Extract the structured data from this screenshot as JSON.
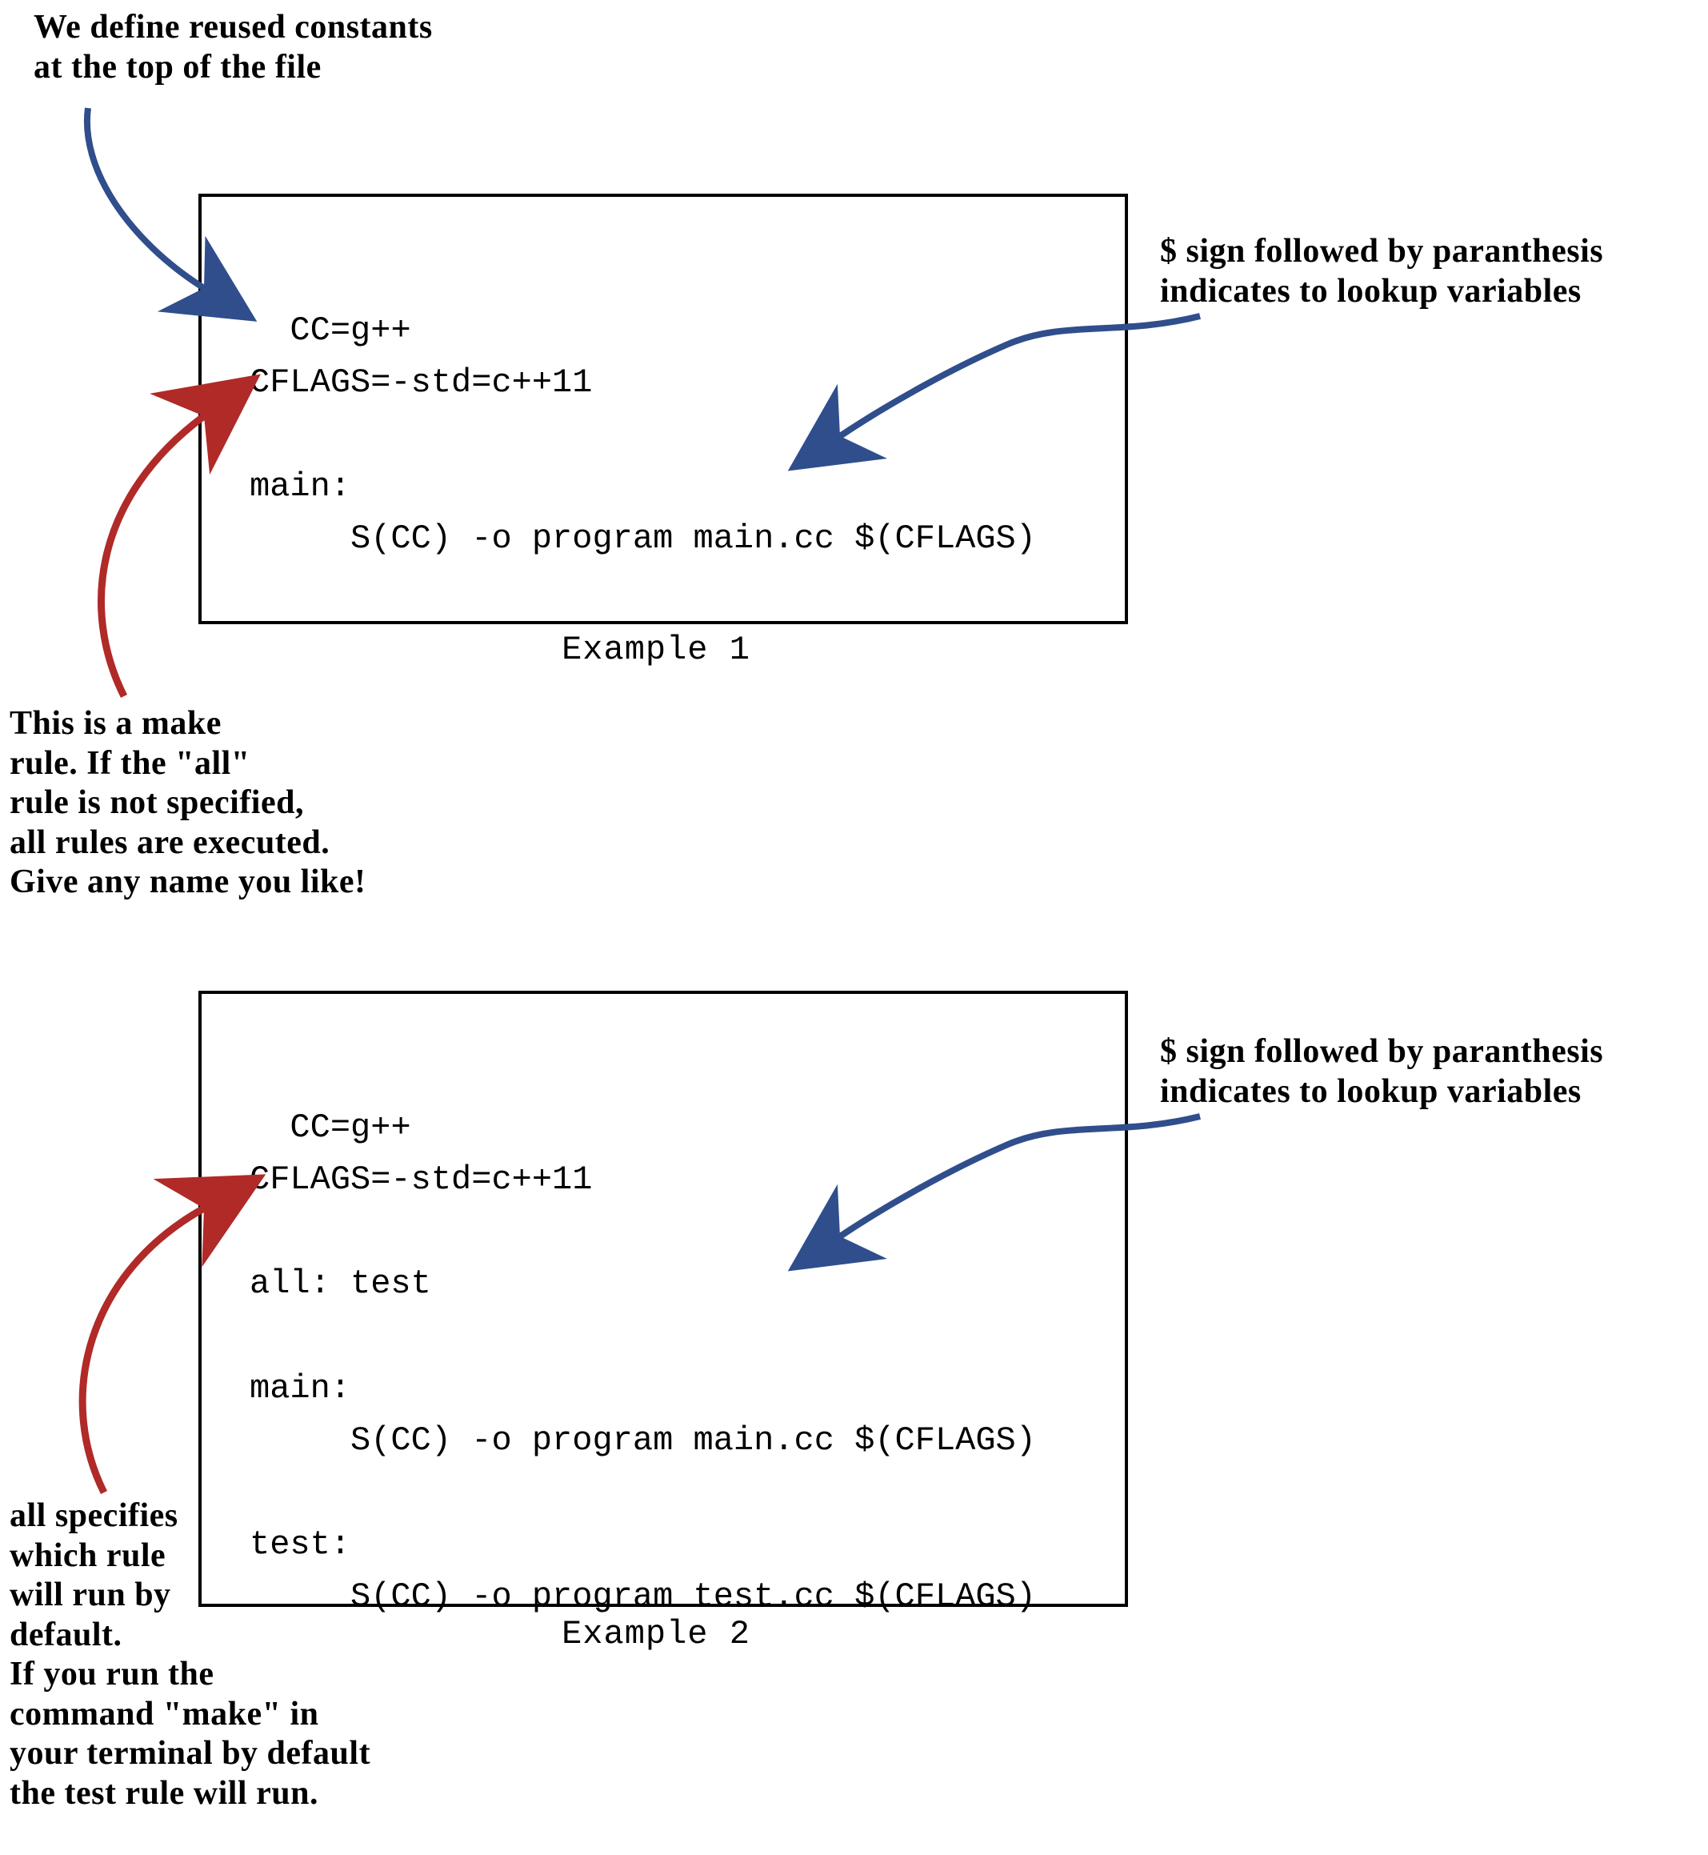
{
  "notes": {
    "constants_top": "We define reused constants\nat the top of the file",
    "dollar_lookup_1": "$ sign followed by paranthesis\nindicates to lookup variables",
    "make_rule": "This is a make\nrule. If the \"all\"\nrule is not specified,\nall rules are executed.\nGive any name you like!",
    "dollar_lookup_2": "$ sign followed by paranthesis\nindicates to lookup variables",
    "all_specifies": "all specifies\nwhich rule\nwill run by\ndefault.\nIf you run the\ncommand \"make\" in\nyour terminal by default\nthe test rule will run."
  },
  "example1": {
    "code": "CC=g++\nCFLAGS=-std=c++11\n\nmain:\n     S(CC) -o program main.cc $(CFLAGS)",
    "caption": "Example 1"
  },
  "example2": {
    "code": "CC=g++\nCFLAGS=-std=c++11\n\nall: test\n\nmain:\n     S(CC) -o program main.cc $(CFLAGS)\n\ntest:\n     S(CC) -o program test.cc $(CFLAGS)",
    "caption": "Example 2"
  },
  "colors": {
    "arrow_blue": "#304E8C",
    "arrow_red": "#B02A28"
  }
}
